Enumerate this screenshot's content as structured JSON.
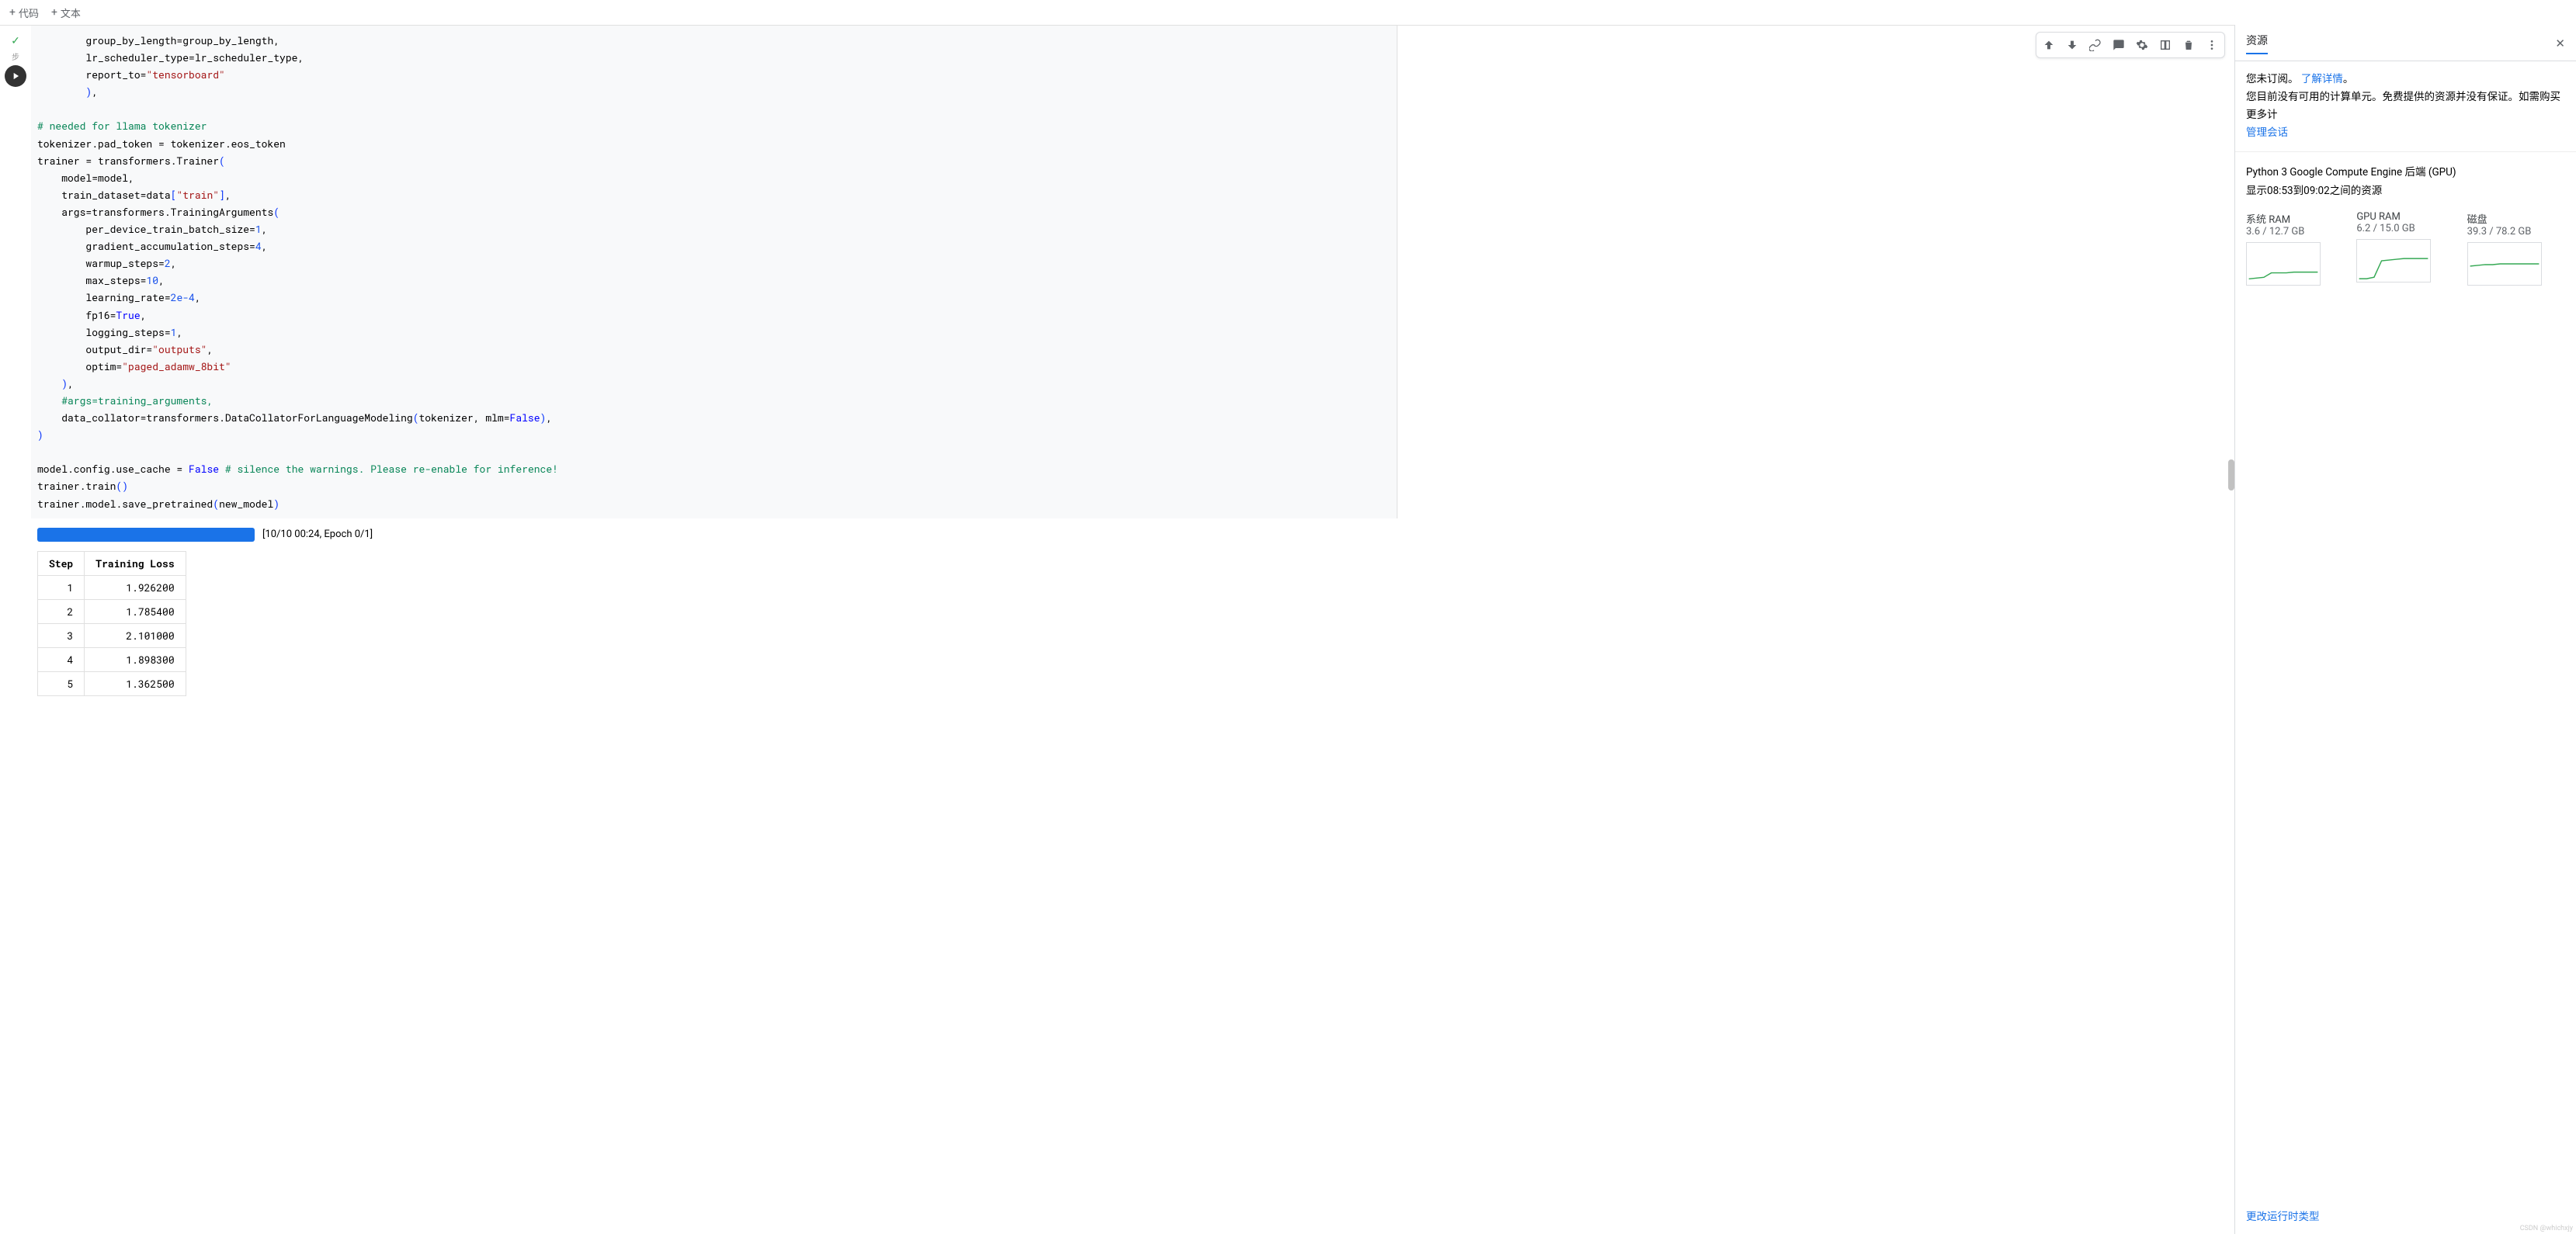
{
  "top": {
    "add_code": "代码",
    "add_text": "文本"
  },
  "gutter": {
    "step_label": "步"
  },
  "toolbar": {
    "move_up": "arrow-up",
    "move_down": "arrow-down",
    "link": "link",
    "comment": "comment",
    "settings": "gear",
    "mirror": "mirror",
    "delete": "trash",
    "more": "more"
  },
  "code": {
    "l1": "        group_by_length=group_by_length,",
    "l2": "        lr_scheduler_type=lr_scheduler_type,",
    "l3_a": "        report_to=",
    "l3_b": "\"tensorboard\"",
    "l4_a": "        ",
    "l4_b": ")",
    "l4_c": ",",
    "blank1": "",
    "c1": "# needed for llama tokenizer",
    "l5": "tokenizer.pad_token = tokenizer.eos_token",
    "l6_a": "trainer = transformers.Trainer",
    "l6_b": "(",
    "l7": "    model=model,",
    "l8_a": "    train_dataset=data",
    "l8_b": "[",
    "l8_c": "\"train\"",
    "l8_d": "]",
    "l8_e": ",",
    "l9_a": "    args=transformers.TrainingArguments",
    "l9_b": "(",
    "l10_a": "        per_device_train_batch_size=",
    "l10_b": "1",
    "l10_c": ",",
    "l11_a": "        gradient_accumulation_steps=",
    "l11_b": "4",
    "l11_c": ",",
    "l12_a": "        warmup_steps=",
    "l12_b": "2",
    "l12_c": ",",
    "l13_a": "        max_steps=",
    "l13_b": "10",
    "l13_c": ",",
    "l14_a": "        learning_rate=",
    "l14_b": "2e-4",
    "l14_c": ",",
    "l15_a": "        fp16=",
    "l15_b": "True",
    "l15_c": ",",
    "l16_a": "        logging_steps=",
    "l16_b": "1",
    "l16_c": ",",
    "l17_a": "        output_dir=",
    "l17_b": "\"outputs\"",
    "l17_c": ",",
    "l18_a": "        optim=",
    "l18_b": "\"paged_adamw_8bit\"",
    "l19_a": "    ",
    "l19_b": ")",
    "l19_c": ",",
    "c2": "    #args=training_arguments,",
    "l20_a": "    data_collator=transformers.DataCollatorForLanguageModeling",
    "l20_b": "(",
    "l20_c": "tokenizer, mlm=",
    "l20_d": "False",
    "l20_e": ")",
    "l20_f": ",",
    "l21": ")",
    "blank2": "",
    "l22_a": "model.config.use_cache = ",
    "l22_b": "False",
    "l22_c": " ",
    "l22_d": "# silence the warnings. Please re-enable for inference!",
    "l23_a": "trainer.train",
    "l23_b": "()",
    "l24_a": "trainer.model.save_pretrained",
    "l24_b": "(",
    "l24_c": "new_model",
    "l24_d": ")"
  },
  "output": {
    "progress_text": "[10/10 00:24, Epoch 0/1]",
    "progress_pct": 100,
    "table": {
      "headers": [
        "Step",
        "Training Loss"
      ],
      "rows": [
        [
          "1",
          "1.926200"
        ],
        [
          "2",
          "1.785400"
        ],
        [
          "3",
          "2.101000"
        ],
        [
          "4",
          "1.898300"
        ],
        [
          "5",
          "1.362500"
        ]
      ]
    }
  },
  "panel": {
    "title": "资源",
    "notice_a": "您未订阅。",
    "notice_link": "了解详情",
    "notice_b": "。",
    "notice_c": "您目前没有可用的计算单元。免费提供的资源并没有保证。如需购买更多计",
    "manage_link": "管理会话",
    "backend": "Python 3 Google Compute Engine 后端 (GPU)",
    "shown": "显示08:53到09:02之间的资源",
    "charts": {
      "ram_label": "系统 RAM",
      "ram_value": "3.6 / 12.7 GB",
      "gpu_label": "GPU RAM",
      "gpu_value": "6.2 / 15.0 GB",
      "disk_label": "磁盘",
      "disk_value": "39.3 / 78.2 GB"
    },
    "footer_link": "更改运行时类型"
  },
  "chart_data": [
    {
      "type": "line",
      "title": "系统 RAM",
      "ylim": [
        0,
        12.7
      ],
      "x": [
        0,
        1,
        2,
        3,
        4,
        5,
        6,
        7,
        8,
        9
      ],
      "values": [
        2.8,
        2.9,
        3.0,
        3.5,
        3.5,
        3.5,
        3.6,
        3.6,
        3.6,
        3.6
      ]
    },
    {
      "type": "line",
      "title": "GPU RAM",
      "ylim": [
        0,
        15.0
      ],
      "x": [
        0,
        1,
        2,
        3,
        4,
        5,
        6,
        7,
        8,
        9
      ],
      "values": [
        1.0,
        1.0,
        1.2,
        5.8,
        6.0,
        6.1,
        6.2,
        6.2,
        6.2,
        6.2
      ]
    },
    {
      "type": "line",
      "title": "磁盘",
      "ylim": [
        0,
        78.2
      ],
      "x": [
        0,
        1,
        2,
        3,
        4,
        5,
        6,
        7,
        8,
        9
      ],
      "values": [
        37,
        38,
        39,
        39,
        39.2,
        39.3,
        39.3,
        39.3,
        39.3,
        39.3
      ]
    }
  ],
  "watermark": "CSDN @whichxjy"
}
